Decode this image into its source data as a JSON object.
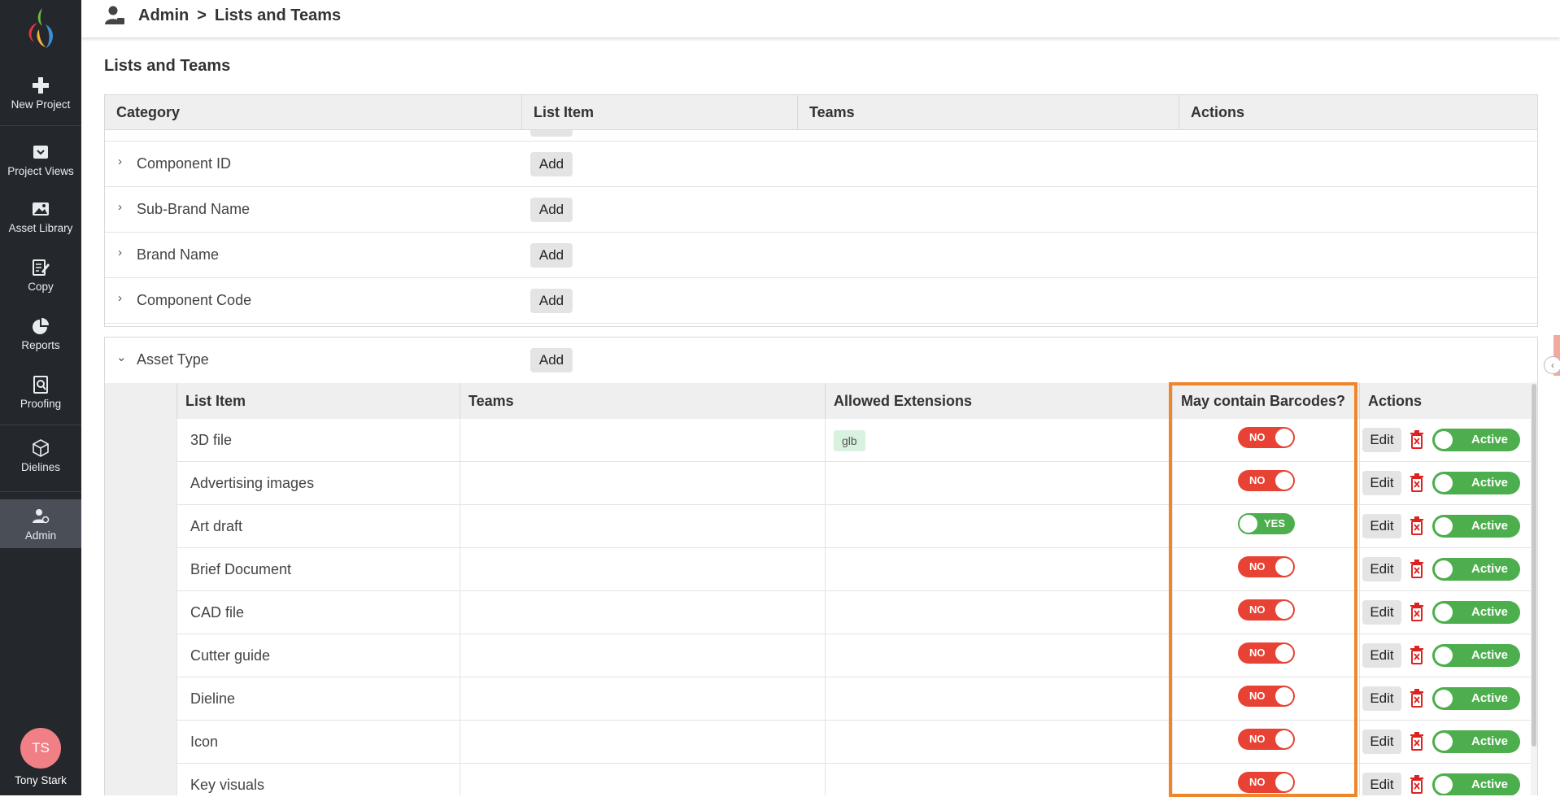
{
  "sidebar": {
    "items": [
      {
        "label": "New Project",
        "icon": "plus-icon"
      },
      {
        "label": "Project Views",
        "icon": "inbox-icon"
      },
      {
        "label": "Asset Library",
        "icon": "image-icon"
      },
      {
        "label": "Copy",
        "icon": "edit-doc-icon"
      },
      {
        "label": "Reports",
        "icon": "pie-chart-icon"
      },
      {
        "label": "Proofing",
        "icon": "search-doc-icon"
      },
      {
        "label": "Dielines",
        "icon": "box-icon"
      },
      {
        "label": "Admin",
        "icon": "admin-user-icon"
      }
    ],
    "user": {
      "initials": "TS",
      "name": "Tony Stark"
    }
  },
  "breadcrumb": {
    "root": "Admin",
    "separator": ">",
    "current": "Lists and Teams"
  },
  "page_title": "Lists and Teams",
  "category_table": {
    "headers": [
      "Category",
      "List Item",
      "Teams",
      "Actions"
    ],
    "rows": [
      {
        "label": "Component ID",
        "add": "Add"
      },
      {
        "label": "Sub-Brand Name",
        "add": "Add"
      },
      {
        "label": "Brand Name",
        "add": "Add"
      },
      {
        "label": "Component Code",
        "add": "Add"
      }
    ]
  },
  "asset_type": {
    "label": "Asset Type",
    "add": "Add",
    "headers": [
      "List Item",
      "Teams",
      "Allowed Extensions",
      "May contain Barcodes?",
      "Actions"
    ],
    "rows": [
      {
        "name": "3D file",
        "ext": "glb",
        "barcode": "NO",
        "edit": "Edit",
        "status": "Active"
      },
      {
        "name": "Advertising images",
        "ext": "",
        "barcode": "NO",
        "edit": "Edit",
        "status": "Active"
      },
      {
        "name": "Art draft",
        "ext": "",
        "barcode": "YES",
        "edit": "Edit",
        "status": "Active"
      },
      {
        "name": "Brief Document",
        "ext": "",
        "barcode": "NO",
        "edit": "Edit",
        "status": "Active"
      },
      {
        "name": "CAD file",
        "ext": "",
        "barcode": "NO",
        "edit": "Edit",
        "status": "Active"
      },
      {
        "name": "Cutter guide",
        "ext": "",
        "barcode": "NO",
        "edit": "Edit",
        "status": "Active"
      },
      {
        "name": "Dieline",
        "ext": "",
        "barcode": "NO",
        "edit": "Edit",
        "status": "Active"
      },
      {
        "name": "Icon",
        "ext": "",
        "barcode": "NO",
        "edit": "Edit",
        "status": "Active"
      },
      {
        "name": "Key visuals",
        "ext": "",
        "barcode": "NO",
        "edit": "Edit",
        "status": "Active"
      }
    ]
  },
  "colors": {
    "sidebar_bg": "#24272c",
    "no_red": "#e84234",
    "yes_green": "#4cae4c",
    "highlight_orange": "#f0862b"
  }
}
